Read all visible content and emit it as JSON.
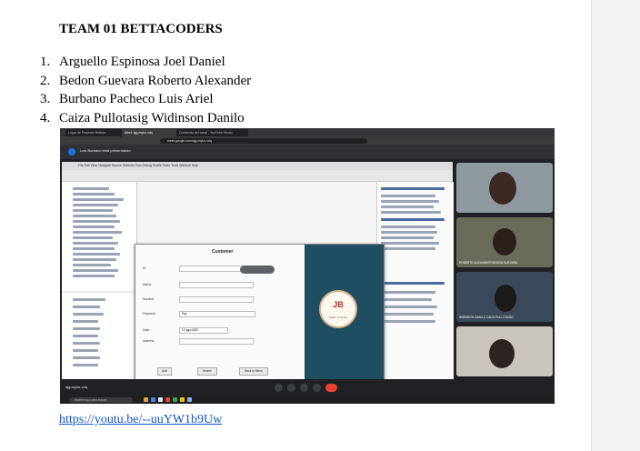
{
  "document": {
    "title": "TEAM 01 BETTACODERS",
    "members": [
      {
        "num": "1.",
        "name": "Arguello Espinosa Joel Daniel"
      },
      {
        "num": "2.",
        "name": "Bedon Guevara Roberto Alexander"
      },
      {
        "num": "3.",
        "name": "Burbano Pacheco Luis Ariel"
      },
      {
        "num": "4.",
        "name": "Caiza Pullotasig Widinson Danilo"
      }
    ],
    "link": "https://youtu.be/--uuYW1b9Uw"
  },
  "screenshot": {
    "browser_tabs": [
      "Lugar de Proyecto Bettaco",
      "Meet: ajg-myko-vdq",
      "Contenido del canal - YouTube Studio"
    ],
    "url": "meet.google.com/ajg-myko-vdq",
    "presenter_label": "Luis Burbano está presentando",
    "ide_menu": "File  Edit  View  Navigate  Source  Refactor  Run  Debug  Profile  Team  Tools  Window  Help",
    "dialog": {
      "title": "Customer",
      "fields": [
        "ID",
        "Name",
        "Number",
        "Payment",
        "Date",
        "Address"
      ],
      "payment_value": "Pay",
      "date_value": "17-ago-2022",
      "buttons": [
        "Add",
        "Search",
        "Back to Menu"
      ],
      "logo_text": "Made To Smile"
    },
    "participants": [
      "ROBERTO ALEXANDER BEDON GUEVARA",
      "WIDINSON DANILO CAIZA PULLOTASIG"
    ],
    "meeting_code": "ajg-myko-vdq",
    "search_placeholder": "Escribe aquí para buscar"
  }
}
